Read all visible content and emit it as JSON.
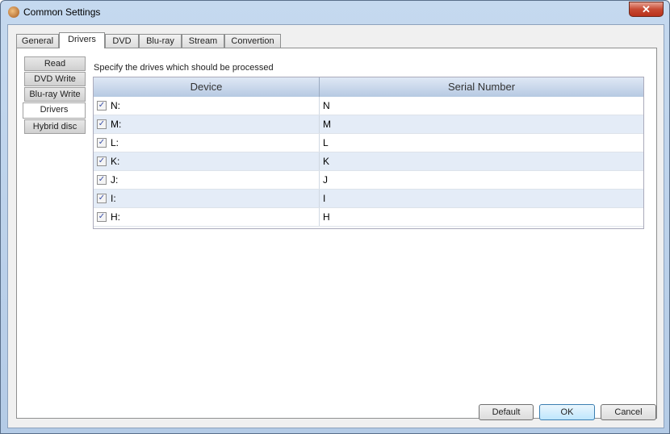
{
  "window": {
    "title": "Common Settings",
    "close": "✕"
  },
  "tabs": [
    "General",
    "Drivers",
    "DVD",
    "Blu-ray",
    "Stream",
    "Convertion"
  ],
  "side_tabs": [
    "Read",
    "DVD Write",
    "Blu-ray Write",
    "Drivers",
    "Hybrid disc"
  ],
  "hint": "Specify the drives which should be processed",
  "grid": {
    "headers": [
      "Device",
      "Serial Number"
    ],
    "rows": [
      {
        "device": "N:",
        "serial": "N",
        "checked": true
      },
      {
        "device": "M:",
        "serial": "M",
        "checked": true
      },
      {
        "device": "L:",
        "serial": "L",
        "checked": true
      },
      {
        "device": "K:",
        "serial": "K",
        "checked": true
      },
      {
        "device": "J:",
        "serial": "J",
        "checked": true
      },
      {
        "device": "I:",
        "serial": "I",
        "checked": true
      },
      {
        "device": "H:",
        "serial": "H",
        "checked": true
      }
    ]
  },
  "buttons": {
    "default": "Default",
    "ok": "OK",
    "cancel": "Cancel"
  },
  "check_glyph": "✓"
}
